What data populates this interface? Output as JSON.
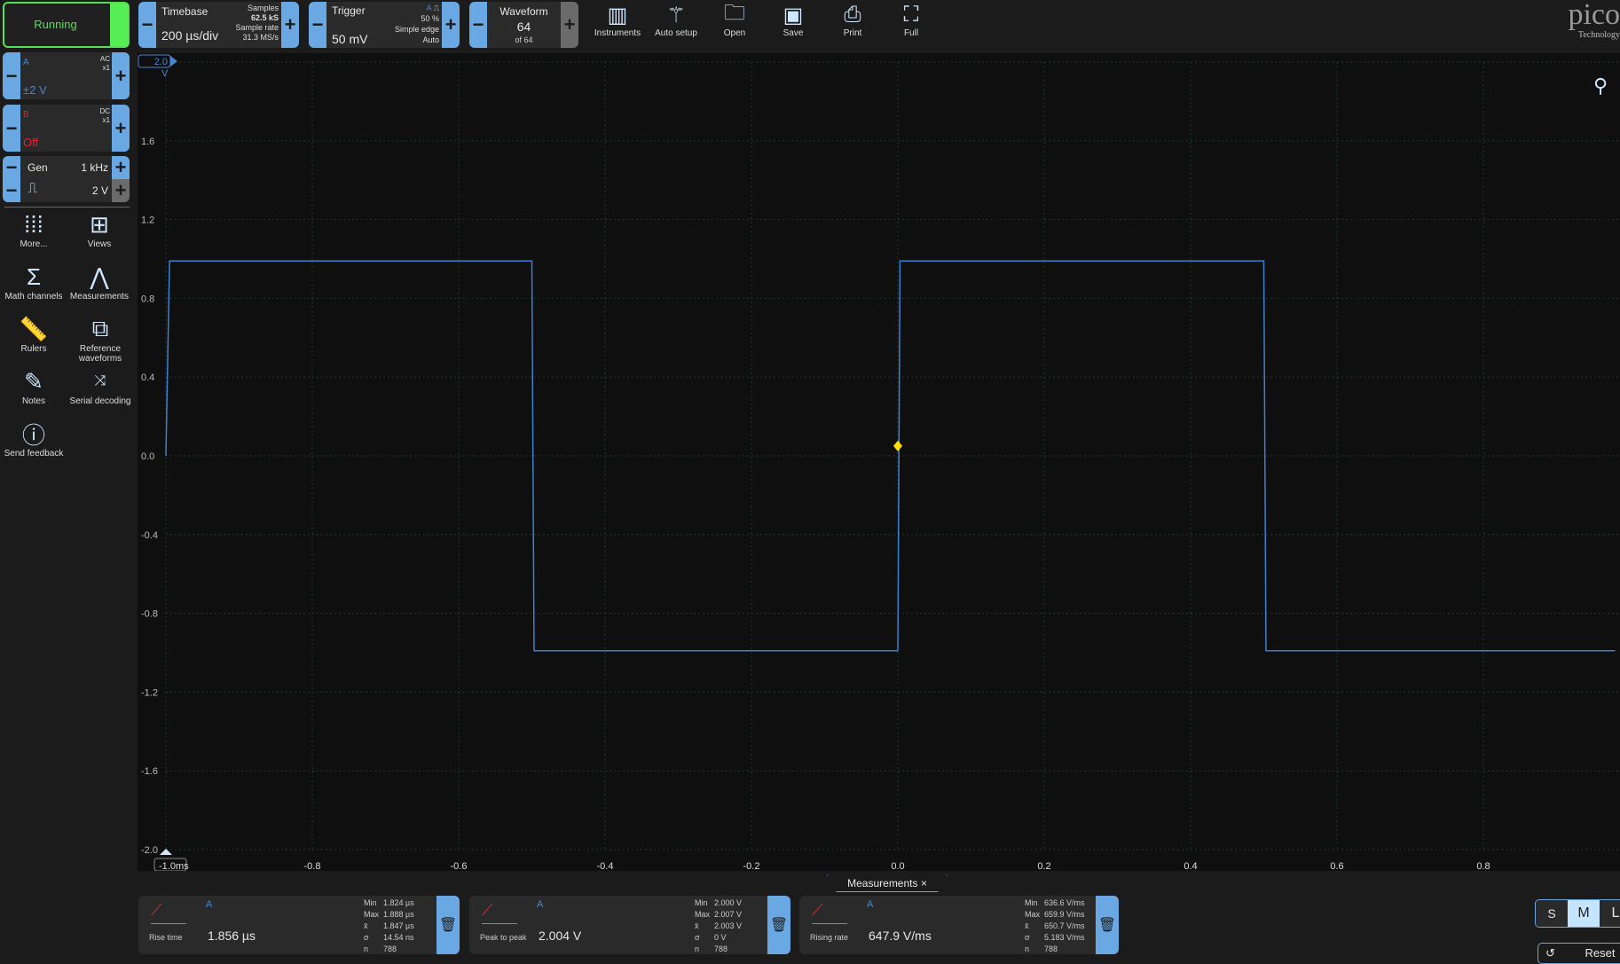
{
  "toolbar": {
    "run_state": "Running",
    "timebase": {
      "label": "Timebase",
      "value": "200 µs/div",
      "samples_label": "Samples",
      "samples": "62.5 kS",
      "rate_label": "Sample rate",
      "rate": "31.3 MS/s"
    },
    "trigger": {
      "label": "Trigger",
      "value": "50 mV",
      "channel": "A",
      "level": "50 %",
      "type": "Simple edge",
      "mode": "Auto"
    },
    "waveform": {
      "label": "Waveform",
      "value": "64",
      "of": "of 64"
    },
    "buttons": [
      {
        "label": "Instruments",
        "icon": "instruments-icon"
      },
      {
        "label": "Auto setup",
        "icon": "wand-icon"
      },
      {
        "label": "Open",
        "icon": "folder-icon"
      },
      {
        "label": "Save",
        "icon": "save-icon"
      },
      {
        "label": "Print",
        "icon": "print-icon"
      },
      {
        "label": "Full",
        "icon": "fullscreen-icon"
      }
    ],
    "logo": "pico",
    "logo_sub": "Technology"
  },
  "channels": [
    {
      "name": "A",
      "coupling": "AC",
      "probe": "x1",
      "range": "±2 V",
      "color": "#4a86d0"
    },
    {
      "name": "B",
      "coupling": "DC",
      "probe": "x1",
      "range": "Off",
      "color": "#e8203a"
    }
  ],
  "generator": {
    "label": "Gen",
    "freq": "1 kHz",
    "amplitude": "2 V"
  },
  "sidebar": [
    {
      "label": "More...",
      "icon": "dots-grid-icon"
    },
    {
      "label": "Views",
      "icon": "views-grid-icon"
    },
    {
      "label": "Math channels",
      "icon": "sigma-icon"
    },
    {
      "label": "Measurements",
      "icon": "compass-icon"
    },
    {
      "label": "Rulers",
      "icon": "ruler-icon"
    },
    {
      "label": "Reference waveforms",
      "icon": "reference-icon"
    },
    {
      "label": "Notes",
      "icon": "notes-icon"
    },
    {
      "label": "Serial decoding",
      "icon": "serial-icon"
    },
    {
      "label": "Send feedback",
      "icon": "feedback-icon"
    }
  ],
  "plot": {
    "y_unit": "V",
    "y_top": "2.0",
    "y_ticks": [
      "1.6",
      "1.2",
      "0.8",
      "0.4",
      "0.0",
      "-0.4",
      "-0.8",
      "-1.2",
      "-1.6",
      "-2.0"
    ],
    "x_first": "-1.0ms",
    "x_ticks": [
      "-0.8",
      "-0.6",
      "-0.4",
      "-0.2",
      "0.0",
      "0.2",
      "0.4",
      "0.6",
      "0.8"
    ],
    "trace_color": "#3f7fcf",
    "trigger_marker_color": "#ffe100",
    "trace_points_ms_v": [
      [
        -1.0,
        0.0
      ],
      [
        -0.995,
        0.99
      ],
      [
        -0.5,
        0.99
      ],
      [
        -0.497,
        -0.99
      ],
      [
        0.0,
        -0.99
      ],
      [
        0.003,
        0.99
      ],
      [
        0.5,
        0.99
      ],
      [
        0.503,
        -0.99
      ],
      [
        0.98,
        -0.99
      ]
    ],
    "trigger_point": [
      0.0,
      0.05
    ]
  },
  "measurements_tab": {
    "label": "Measurements",
    "close": "×"
  },
  "measurements": [
    {
      "name": "Rise time",
      "channel": "A",
      "value": "1.856 µs",
      "min": "1.824 µs",
      "max": "1.888 µs",
      "mean": "1.847 µs",
      "sd": "14.54 ns",
      "n": "788"
    },
    {
      "name": "Peak to peak",
      "channel": "A",
      "value": "2.004 V",
      "min": "2.000 V",
      "max": "2.007 V",
      "mean": "2.003 V",
      "sd": "0 V",
      "n": "788"
    },
    {
      "name": "Rising rate",
      "channel": "A",
      "value": "647.9 V/ms",
      "min": "636.6 V/ms",
      "max": "659.9 V/ms",
      "mean": "650.7 V/ms",
      "sd": "5.183 V/ms",
      "n": "788"
    }
  ],
  "stat_labels": {
    "min": "Min",
    "max": "Max",
    "mean": "x̄",
    "sd": "σ",
    "n": "n"
  },
  "size": {
    "options": [
      "S",
      "M",
      "L"
    ],
    "selected": "M"
  },
  "reset": "Reset"
}
